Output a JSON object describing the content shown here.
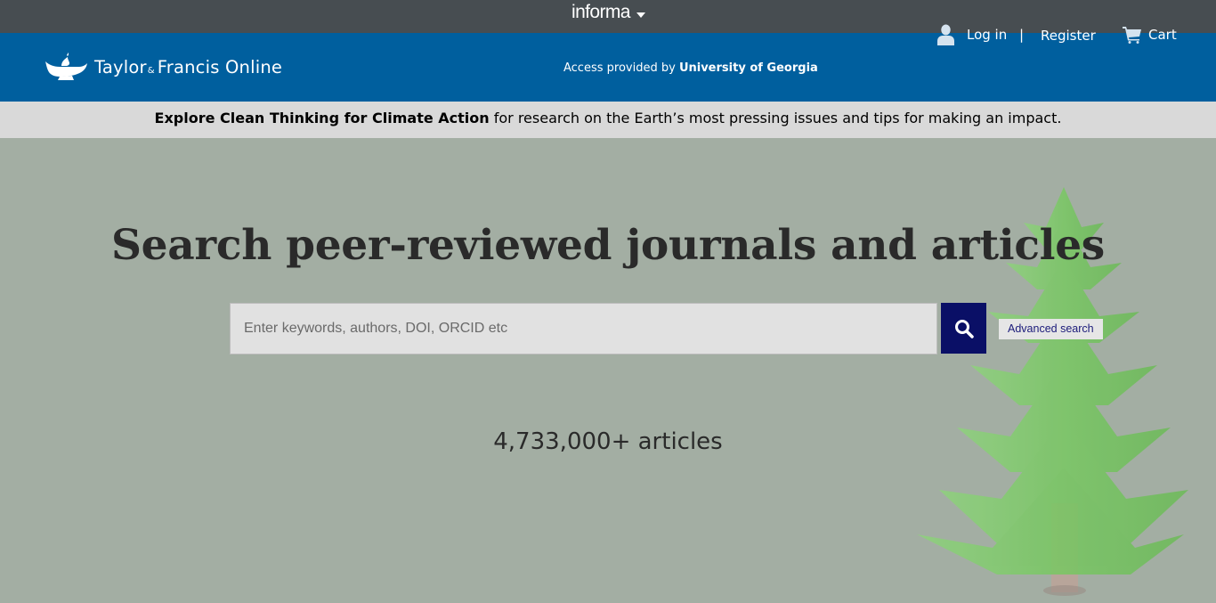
{
  "informa_bar": {
    "brand": "informa"
  },
  "header": {
    "logo": {
      "name": "Taylor",
      "amp": "&",
      "name2": "Francis Online"
    },
    "access": {
      "prefix": "Access provided by",
      "institution": "University of Georgia"
    },
    "login_label": "Log in",
    "divider": "|",
    "register_label": "Register",
    "cart_label": "Cart"
  },
  "promo": {
    "link": "Explore Clean Thinking for Climate Action",
    "text": " for research on the Earth’s most pressing issues and tips for making an impact."
  },
  "hero": {
    "headline": "Search peer-reviewed journals and articles",
    "search_placeholder": "Enter keywords, authors, DOI, ORCID etc",
    "search_value": "",
    "advanced_label": "Advanced search",
    "count": "4,733,000+ articles"
  },
  "colors": {
    "informa_bar": "#474d51",
    "header": "#005f9e",
    "promo": "#d9d9d9",
    "hero": "#a3aea3",
    "search_button": "#0a0f66"
  },
  "icons": [
    "lamp-logo-icon",
    "chevron-down-icon",
    "user-icon",
    "cart-icon",
    "search-icon",
    "pine-tree-illustration"
  ]
}
